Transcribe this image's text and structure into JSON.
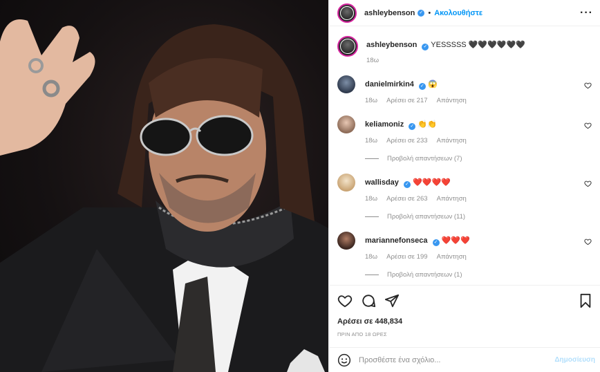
{
  "post": {
    "author": "ashleybenson",
    "follow_label": "Ακολουθήστε",
    "separator": "•",
    "more_icon": "more-horizontal-icon"
  },
  "caption": {
    "username": "ashleybenson",
    "text": "YESSSSS 🖤🖤🖤🖤🖤🖤",
    "age": "18ω"
  },
  "comments": [
    {
      "username": "danielmirkin4",
      "text": "😱",
      "age": "18ω",
      "likes": "Αρέσει σε 217",
      "reply": "Απάντηση",
      "view_replies": ""
    },
    {
      "username": "keliamoniz",
      "text": "👏👏",
      "age": "18ω",
      "likes": "Αρέσει σε 233",
      "reply": "Απάντηση",
      "view_replies": "Προβολή απαντήσεων (7)"
    },
    {
      "username": "wallisday",
      "text": "❤️❤️❤️❤️",
      "age": "18ω",
      "likes": "Αρέσει σε 263",
      "reply": "Απάντηση",
      "view_replies": "Προβολή απαντήσεων (11)"
    },
    {
      "username": "mariannefonseca",
      "text": "❤️❤️❤️",
      "age": "18ω",
      "likes": "Αρέσει σε 199",
      "reply": "Απάντηση",
      "view_replies": "Προβολή απαντήσεων (1)"
    }
  ],
  "engagement": {
    "likes": "Αρέσει σε 448,834",
    "time": "ΠΡΙΝ ΑΠΟ 18 ΩΡΕΣ"
  },
  "add_comment": {
    "emoji_icon": "smiley-icon",
    "placeholder": "Προσθέστε ένα σχόλιο...",
    "post_label": "Δημοσίευση"
  },
  "colors": {
    "accent": "#0095f6",
    "verified": "#3897f0",
    "story_ring": "#d6249f",
    "muted": "#8e8e8e",
    "post_disabled": "#b2dffc"
  }
}
